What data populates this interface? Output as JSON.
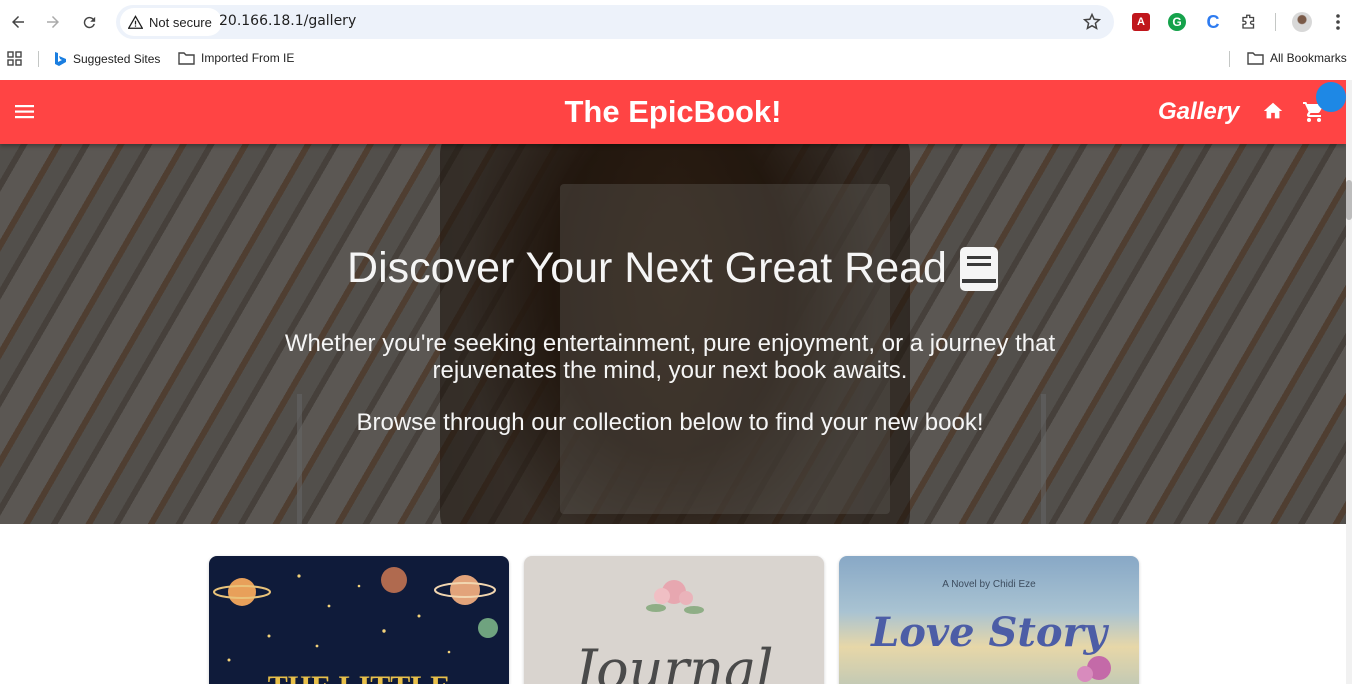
{
  "browser": {
    "security_label": "Not secure",
    "url": "20.166.18.1/gallery",
    "bookmarks": [
      {
        "label": "Suggested Sites"
      },
      {
        "label": "Imported From IE"
      }
    ],
    "all_bookmarks": "All Bookmarks",
    "extensions": [
      "pdf-extension-icon",
      "grammarly-icon",
      "c-extension-icon",
      "puzzle-extensions-icon"
    ]
  },
  "app": {
    "brand": "The EpicBook!",
    "gallery": "Gallery",
    "accent": "#ff4444",
    "badge_color": "#1e88e5"
  },
  "hero": {
    "title": "Discover Your Next Great Read",
    "line1": "Whether you're seeking entertainment, pure enjoyment, or a journey that rejuvenates the mind, your next book awaits.",
    "line2": "Browse through our collection below to find your new book!"
  },
  "books": [
    {
      "cover_text": "THE LITTLE",
      "theme": "space"
    },
    {
      "cover_text": "Journal",
      "theme": "floral"
    },
    {
      "cover_text": "Love Story",
      "subtitle": "A Novel by Chidi Eze",
      "theme": "beach"
    }
  ]
}
